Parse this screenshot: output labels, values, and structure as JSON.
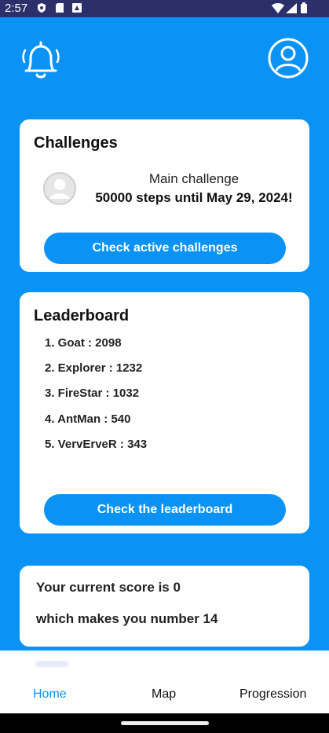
{
  "status_bar": {
    "time": "2:57"
  },
  "challenges": {
    "title": "Challenges",
    "main_label": "Main challenge",
    "main_detail": "50000 steps until May 29, 2024!",
    "button": "Check active challenges"
  },
  "leaderboard": {
    "title": "Leaderboard",
    "entries": [
      "1. Goat : 2098",
      "2. Explorer : 1232",
      "3. FireStar : 1032",
      "4. AntMan : 540",
      "5. VervErveR : 343"
    ],
    "button": "Check the leaderboard"
  },
  "score": {
    "line1": "Your current score is 0",
    "line2": "which makes you number 14"
  },
  "nav": {
    "items": [
      {
        "label": "Home",
        "active": true
      },
      {
        "label": "Map",
        "active": false
      },
      {
        "label": "Progression",
        "active": false
      }
    ]
  },
  "colors": {
    "primary": "#0a93f5",
    "status_bar": "#2b2f6a",
    "card": "#ffffff",
    "nav_active": "#0a93f5"
  },
  "icons": [
    "bell-icon",
    "profile-icon",
    "avatar-icon"
  ]
}
